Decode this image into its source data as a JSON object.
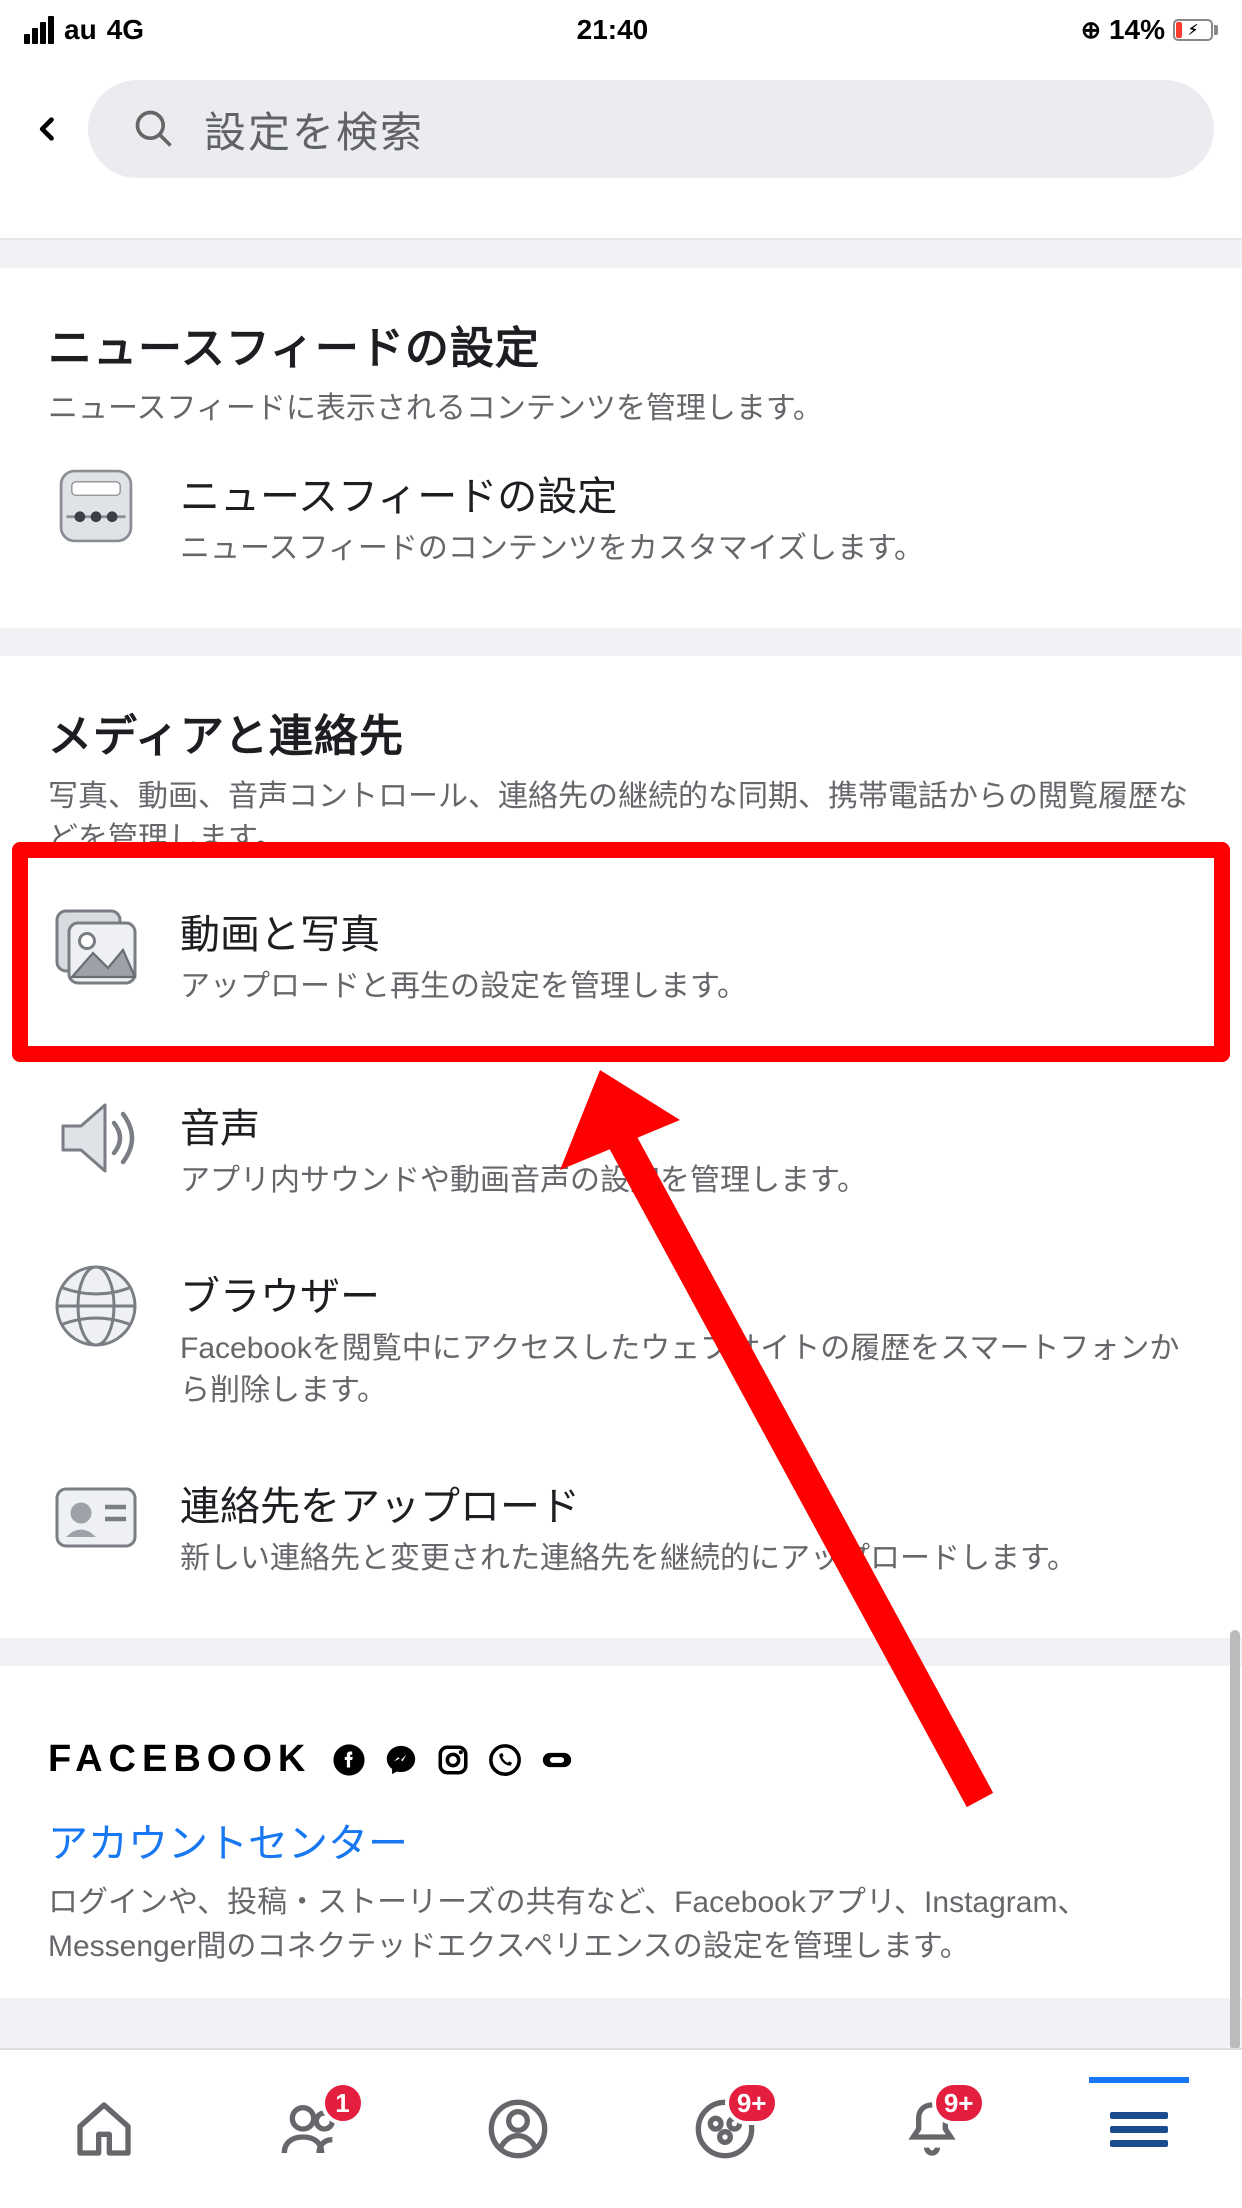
{
  "statusbar": {
    "carrier": "au",
    "network": "4G",
    "time": "21:40",
    "battery_pct": "14%"
  },
  "header": {
    "search_placeholder": "設定を検索"
  },
  "sections": {
    "newsfeed": {
      "title": "ニュースフィードの設定",
      "desc": "ニュースフィードに表示されるコンテンツを管理します。",
      "item": {
        "title": "ニュースフィードの設定",
        "sub": "ニュースフィードのコンテンツをカスタマイズします。"
      }
    },
    "media": {
      "title": "メディアと連絡先",
      "desc": "写真、動画、音声コントロール、連絡先の継続的な同期、携帯電話からの閲覧履歴などを管理します。",
      "items": [
        {
          "title": "動画と写真",
          "sub": "アップロードと再生の設定を管理します。"
        },
        {
          "title": "音声",
          "sub": "アプリ内サウンドや動画音声の設定を管理します。"
        },
        {
          "title": "ブラウザー",
          "sub": "Facebookを閲覧中にアクセスしたウェブサイトの履歴をスマートフォンから削除します。"
        },
        {
          "title": "連絡先をアップロード",
          "sub": "新しい連絡先と変更された連絡先を継続的にアップロードします。"
        }
      ]
    },
    "facebook": {
      "wordmark": "FACEBOOK",
      "link": "アカウントセンター",
      "desc": "ログインや、投稿・ストーリーズの共有など、Facebookアプリ、Instagram、Messenger間のコネクテッドエクスペリエンスの設定を管理します。"
    }
  },
  "tabbar": {
    "friends_badge": "1",
    "groups_badge": "9+",
    "notifications_badge": "9+"
  }
}
